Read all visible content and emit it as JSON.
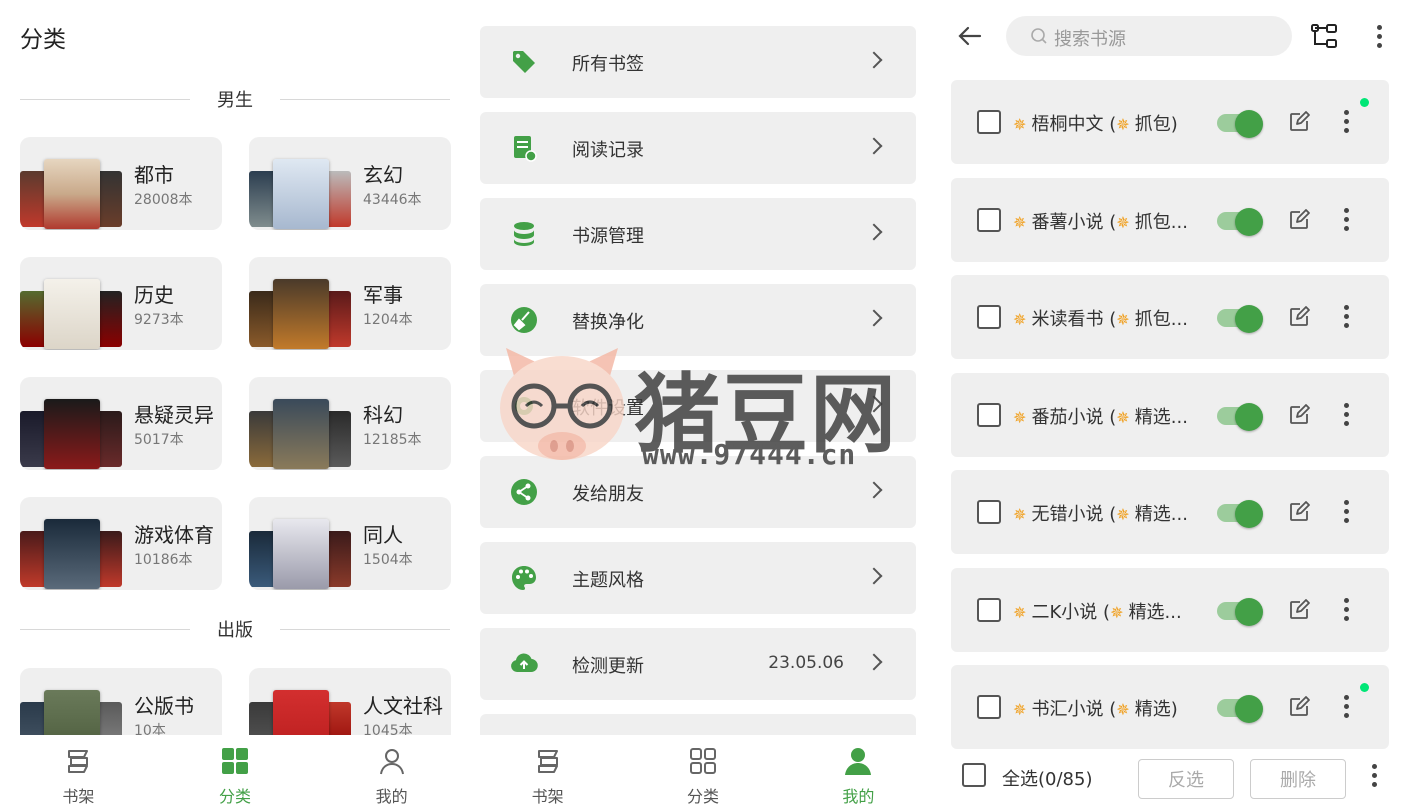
{
  "category_panel": {
    "title": "分类",
    "sections": [
      {
        "label": "男生",
        "items": [
          {
            "name": "都市",
            "count": "28008本"
          },
          {
            "name": "玄幻",
            "count": "43446本"
          },
          {
            "name": "历史",
            "count": "9273本"
          },
          {
            "name": "军事",
            "count": "1204本"
          },
          {
            "name": "悬疑灵异",
            "count": "5017本"
          },
          {
            "name": "科幻",
            "count": "12185本"
          },
          {
            "name": "游戏体育",
            "count": "10186本"
          },
          {
            "name": "同人",
            "count": "1504本"
          }
        ]
      },
      {
        "label": "出版",
        "items": [
          {
            "name": "公版书",
            "count": "10本"
          },
          {
            "name": "人文社科",
            "count": "1045本"
          }
        ]
      }
    ],
    "nav": [
      {
        "label": "书架",
        "icon": "bookshelf-icon",
        "active": false
      },
      {
        "label": "分类",
        "icon": "category-grid-icon",
        "active": true
      },
      {
        "label": "我的",
        "icon": "person-icon",
        "active": false
      }
    ]
  },
  "mine_panel": {
    "menu": [
      {
        "label": "所有书签",
        "icon": "tag-icon",
        "value": ""
      },
      {
        "label": "阅读记录",
        "icon": "reading-record-icon",
        "value": ""
      },
      {
        "label": "书源管理",
        "icon": "database-icon",
        "value": ""
      },
      {
        "label": "替换净化",
        "icon": "broom-icon",
        "value": ""
      },
      {
        "label": "软件设置",
        "icon": "gear-icon",
        "value": ""
      },
      {
        "label": "发给朋友",
        "icon": "share-icon",
        "value": ""
      },
      {
        "label": "主题风格",
        "icon": "palette-icon",
        "value": ""
      },
      {
        "label": "检测更新",
        "icon": "cloud-upload-icon",
        "value": "23.05.06"
      }
    ],
    "nav": [
      {
        "label": "书架",
        "icon": "bookshelf-icon",
        "active": false
      },
      {
        "label": "分类",
        "icon": "category-grid-icon",
        "active": false
      },
      {
        "label": "我的",
        "icon": "person-icon",
        "active": true
      }
    ]
  },
  "watermark": {
    "text": "猪豆网",
    "url": "www.97444.cn"
  },
  "source_panel": {
    "search_placeholder": "搜索书源",
    "sources": [
      {
        "name": "梧桐中文 (",
        "tag": "抓包)",
        "enabled": true,
        "dot": true
      },
      {
        "name": "番薯小说 (",
        "tag": "抓包...",
        "enabled": true,
        "dot": false
      },
      {
        "name": "米读看书 (",
        "tag": "抓包...",
        "enabled": true,
        "dot": false
      },
      {
        "name": "番茄小说 (",
        "tag": "精选...",
        "enabled": true,
        "dot": false
      },
      {
        "name": "无错小说 (",
        "tag": "精选...",
        "enabled": true,
        "dot": false
      },
      {
        "name": "二K小说 (",
        "tag": "精选...",
        "enabled": true,
        "dot": false
      },
      {
        "name": "书汇小说 (",
        "tag": "精选)",
        "enabled": true,
        "dot": true
      }
    ],
    "select_all_label": "全选(0/85)",
    "invert_label": "反选",
    "delete_label": "删除",
    "colors": {
      "accent": "#43a047",
      "dot": "#00e676",
      "spark": "#f0a020"
    }
  }
}
